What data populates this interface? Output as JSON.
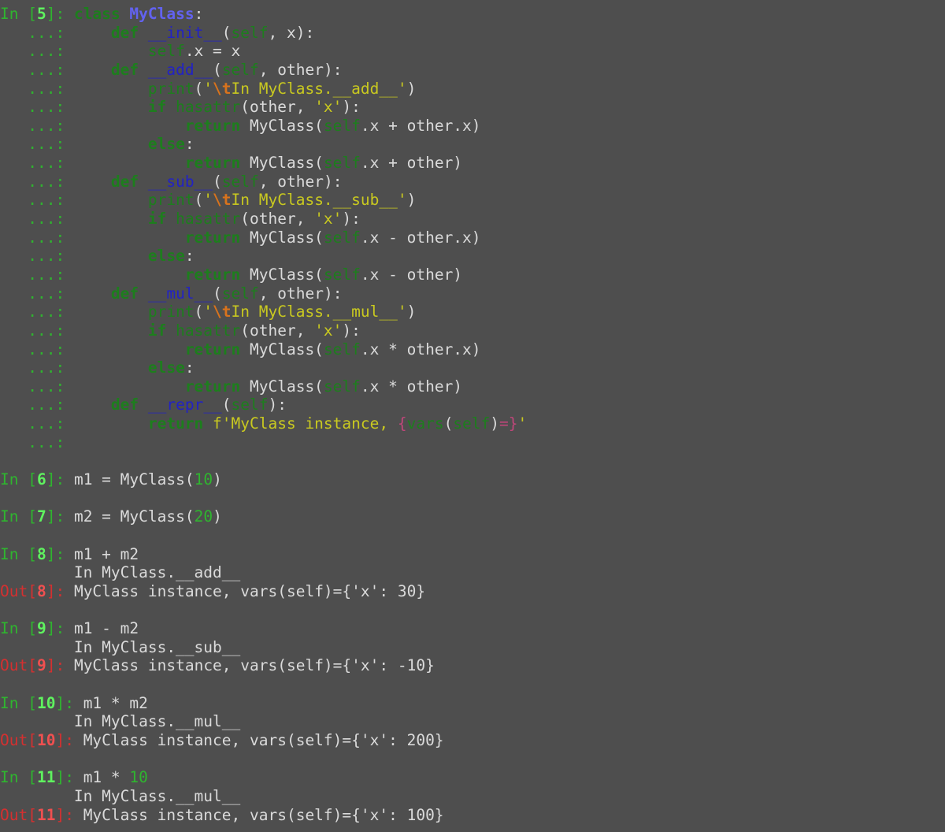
{
  "window": {
    "title": "IPython terminal session"
  },
  "colors": {
    "background": "#4e4e4e",
    "prompt_in": "#2fb52f",
    "prompt_out": "#d43030",
    "keyword": "#1d7e1d",
    "string": "#c9c920",
    "class_name": "#6262f0",
    "function_name": "#2222c4"
  },
  "lines": [
    {
      "segs": [
        {
          "t": "In [",
          "c": "prompt-in"
        },
        {
          "t": "5",
          "c": "prompt-num"
        },
        {
          "t": "]: ",
          "c": "prompt-in"
        },
        {
          "t": "class",
          "c": "kw"
        },
        {
          "t": " ",
          "c": "default"
        },
        {
          "t": "MyClass",
          "c": "classname"
        },
        {
          "t": ":",
          "c": "default"
        }
      ]
    },
    {
      "segs": [
        {
          "t": "   ...: ",
          "c": "cont"
        },
        {
          "t": "    ",
          "c": "default"
        },
        {
          "t": "def",
          "c": "kw"
        },
        {
          "t": " ",
          "c": "default"
        },
        {
          "t": "__init__",
          "c": "func"
        },
        {
          "t": "(",
          "c": "default"
        },
        {
          "t": "self",
          "c": "self"
        },
        {
          "t": ", x):",
          "c": "default"
        }
      ]
    },
    {
      "segs": [
        {
          "t": "   ...: ",
          "c": "cont"
        },
        {
          "t": "        ",
          "c": "default"
        },
        {
          "t": "self",
          "c": "self"
        },
        {
          "t": ".x = x",
          "c": "default"
        }
      ]
    },
    {
      "segs": [
        {
          "t": "   ...: ",
          "c": "cont"
        },
        {
          "t": "    ",
          "c": "default"
        },
        {
          "t": "def",
          "c": "kw"
        },
        {
          "t": " ",
          "c": "default"
        },
        {
          "t": "__add__",
          "c": "func"
        },
        {
          "t": "(",
          "c": "default"
        },
        {
          "t": "self",
          "c": "self"
        },
        {
          "t": ", other):",
          "c": "default"
        }
      ]
    },
    {
      "segs": [
        {
          "t": "   ...: ",
          "c": "cont"
        },
        {
          "t": "        ",
          "c": "default"
        },
        {
          "t": "print",
          "c": "builtin"
        },
        {
          "t": "(",
          "c": "default"
        },
        {
          "t": "'",
          "c": "str"
        },
        {
          "t": "\\t",
          "c": "escape"
        },
        {
          "t": "In MyClass.__add__'",
          "c": "str"
        },
        {
          "t": ")",
          "c": "default"
        }
      ]
    },
    {
      "segs": [
        {
          "t": "   ...: ",
          "c": "cont"
        },
        {
          "t": "        ",
          "c": "default"
        },
        {
          "t": "if",
          "c": "kw"
        },
        {
          "t": " ",
          "c": "default"
        },
        {
          "t": "hasattr",
          "c": "builtin"
        },
        {
          "t": "(other, ",
          "c": "default"
        },
        {
          "t": "'x'",
          "c": "str"
        },
        {
          "t": "):",
          "c": "default"
        }
      ]
    },
    {
      "segs": [
        {
          "t": "   ...: ",
          "c": "cont"
        },
        {
          "t": "            ",
          "c": "default"
        },
        {
          "t": "return",
          "c": "kw"
        },
        {
          "t": " MyClass(",
          "c": "default"
        },
        {
          "t": "self",
          "c": "self"
        },
        {
          "t": ".x + other.x)",
          "c": "default"
        }
      ]
    },
    {
      "segs": [
        {
          "t": "   ...: ",
          "c": "cont"
        },
        {
          "t": "        ",
          "c": "default"
        },
        {
          "t": "else",
          "c": "kw"
        },
        {
          "t": ":",
          "c": "default"
        }
      ]
    },
    {
      "segs": [
        {
          "t": "   ...: ",
          "c": "cont"
        },
        {
          "t": "            ",
          "c": "default"
        },
        {
          "t": "return",
          "c": "kw"
        },
        {
          "t": " MyClass(",
          "c": "default"
        },
        {
          "t": "self",
          "c": "self"
        },
        {
          "t": ".x + other)",
          "c": "default"
        }
      ]
    },
    {
      "segs": [
        {
          "t": "   ...: ",
          "c": "cont"
        },
        {
          "t": "    ",
          "c": "default"
        },
        {
          "t": "def",
          "c": "kw"
        },
        {
          "t": " ",
          "c": "default"
        },
        {
          "t": "__sub__",
          "c": "func"
        },
        {
          "t": "(",
          "c": "default"
        },
        {
          "t": "self",
          "c": "self"
        },
        {
          "t": ", other):",
          "c": "default"
        }
      ]
    },
    {
      "segs": [
        {
          "t": "   ...: ",
          "c": "cont"
        },
        {
          "t": "        ",
          "c": "default"
        },
        {
          "t": "print",
          "c": "builtin"
        },
        {
          "t": "(",
          "c": "default"
        },
        {
          "t": "'",
          "c": "str"
        },
        {
          "t": "\\t",
          "c": "escape"
        },
        {
          "t": "In MyClass.__sub__'",
          "c": "str"
        },
        {
          "t": ")",
          "c": "default"
        }
      ]
    },
    {
      "segs": [
        {
          "t": "   ...: ",
          "c": "cont"
        },
        {
          "t": "        ",
          "c": "default"
        },
        {
          "t": "if",
          "c": "kw"
        },
        {
          "t": " ",
          "c": "default"
        },
        {
          "t": "hasattr",
          "c": "builtin"
        },
        {
          "t": "(other, ",
          "c": "default"
        },
        {
          "t": "'x'",
          "c": "str"
        },
        {
          "t": "):",
          "c": "default"
        }
      ]
    },
    {
      "segs": [
        {
          "t": "   ...: ",
          "c": "cont"
        },
        {
          "t": "            ",
          "c": "default"
        },
        {
          "t": "return",
          "c": "kw"
        },
        {
          "t": " MyClass(",
          "c": "default"
        },
        {
          "t": "self",
          "c": "self"
        },
        {
          "t": ".x - other.x)",
          "c": "default"
        }
      ]
    },
    {
      "segs": [
        {
          "t": "   ...: ",
          "c": "cont"
        },
        {
          "t": "        ",
          "c": "default"
        },
        {
          "t": "else",
          "c": "kw"
        },
        {
          "t": ":",
          "c": "default"
        }
      ]
    },
    {
      "segs": [
        {
          "t": "   ...: ",
          "c": "cont"
        },
        {
          "t": "            ",
          "c": "default"
        },
        {
          "t": "return",
          "c": "kw"
        },
        {
          "t": " MyClass(",
          "c": "default"
        },
        {
          "t": "self",
          "c": "self"
        },
        {
          "t": ".x - other)",
          "c": "default"
        }
      ]
    },
    {
      "segs": [
        {
          "t": "   ...: ",
          "c": "cont"
        },
        {
          "t": "    ",
          "c": "default"
        },
        {
          "t": "def",
          "c": "kw"
        },
        {
          "t": " ",
          "c": "default"
        },
        {
          "t": "__mul__",
          "c": "func"
        },
        {
          "t": "(",
          "c": "default"
        },
        {
          "t": "self",
          "c": "self"
        },
        {
          "t": ", other):",
          "c": "default"
        }
      ]
    },
    {
      "segs": [
        {
          "t": "   ...: ",
          "c": "cont"
        },
        {
          "t": "        ",
          "c": "default"
        },
        {
          "t": "print",
          "c": "builtin"
        },
        {
          "t": "(",
          "c": "default"
        },
        {
          "t": "'",
          "c": "str"
        },
        {
          "t": "\\t",
          "c": "escape"
        },
        {
          "t": "In MyClass.__mul__'",
          "c": "str"
        },
        {
          "t": ")",
          "c": "default"
        }
      ]
    },
    {
      "segs": [
        {
          "t": "   ...: ",
          "c": "cont"
        },
        {
          "t": "        ",
          "c": "default"
        },
        {
          "t": "if",
          "c": "kw"
        },
        {
          "t": " ",
          "c": "default"
        },
        {
          "t": "hasattr",
          "c": "builtin"
        },
        {
          "t": "(other, ",
          "c": "default"
        },
        {
          "t": "'x'",
          "c": "str"
        },
        {
          "t": "):",
          "c": "default"
        }
      ]
    },
    {
      "segs": [
        {
          "t": "   ...: ",
          "c": "cont"
        },
        {
          "t": "            ",
          "c": "default"
        },
        {
          "t": "return",
          "c": "kw"
        },
        {
          "t": " MyClass(",
          "c": "default"
        },
        {
          "t": "self",
          "c": "self"
        },
        {
          "t": ".x * other.x)",
          "c": "default"
        }
      ]
    },
    {
      "segs": [
        {
          "t": "   ...: ",
          "c": "cont"
        },
        {
          "t": "        ",
          "c": "default"
        },
        {
          "t": "else",
          "c": "kw"
        },
        {
          "t": ":",
          "c": "default"
        }
      ]
    },
    {
      "segs": [
        {
          "t": "   ...: ",
          "c": "cont"
        },
        {
          "t": "            ",
          "c": "default"
        },
        {
          "t": "return",
          "c": "kw"
        },
        {
          "t": " MyClass(",
          "c": "default"
        },
        {
          "t": "self",
          "c": "self"
        },
        {
          "t": ".x * other)",
          "c": "default"
        }
      ]
    },
    {
      "segs": [
        {
          "t": "   ...: ",
          "c": "cont"
        },
        {
          "t": "    ",
          "c": "default"
        },
        {
          "t": "def",
          "c": "kw"
        },
        {
          "t": " ",
          "c": "default"
        },
        {
          "t": "__repr__",
          "c": "func"
        },
        {
          "t": "(",
          "c": "default"
        },
        {
          "t": "self",
          "c": "self"
        },
        {
          "t": "):",
          "c": "default"
        }
      ]
    },
    {
      "segs": [
        {
          "t": "   ...: ",
          "c": "cont"
        },
        {
          "t": "        ",
          "c": "default"
        },
        {
          "t": "return",
          "c": "kw"
        },
        {
          "t": " ",
          "c": "default"
        },
        {
          "t": "f'MyClass instance, ",
          "c": "str"
        },
        {
          "t": "{",
          "c": "interp"
        },
        {
          "t": "vars",
          "c": "builtin"
        },
        {
          "t": "(",
          "c": "default"
        },
        {
          "t": "self",
          "c": "self"
        },
        {
          "t": ")",
          "c": "default"
        },
        {
          "t": "=}",
          "c": "interp"
        },
        {
          "t": "'",
          "c": "str"
        }
      ]
    },
    {
      "segs": [
        {
          "t": "   ...: ",
          "c": "cont"
        }
      ]
    },
    {
      "segs": []
    },
    {
      "segs": [
        {
          "t": "In [",
          "c": "prompt-in"
        },
        {
          "t": "6",
          "c": "prompt-num"
        },
        {
          "t": "]: ",
          "c": "prompt-in"
        },
        {
          "t": "m1 = MyClass(",
          "c": "default"
        },
        {
          "t": "10",
          "c": "number"
        },
        {
          "t": ")",
          "c": "default"
        }
      ]
    },
    {
      "segs": []
    },
    {
      "segs": [
        {
          "t": "In [",
          "c": "prompt-in"
        },
        {
          "t": "7",
          "c": "prompt-num"
        },
        {
          "t": "]: ",
          "c": "prompt-in"
        },
        {
          "t": "m2 = MyClass(",
          "c": "default"
        },
        {
          "t": "20",
          "c": "number"
        },
        {
          "t": ")",
          "c": "default"
        }
      ]
    },
    {
      "segs": []
    },
    {
      "segs": [
        {
          "t": "In [",
          "c": "prompt-in"
        },
        {
          "t": "8",
          "c": "prompt-num"
        },
        {
          "t": "]: ",
          "c": "prompt-in"
        },
        {
          "t": "m1 + m2",
          "c": "default"
        }
      ]
    },
    {
      "segs": [
        {
          "t": "        In MyClass.__add__",
          "c": "default"
        }
      ]
    },
    {
      "segs": [
        {
          "t": "Out[",
          "c": "out"
        },
        {
          "t": "8",
          "c": "out-num"
        },
        {
          "t": "]: ",
          "c": "out"
        },
        {
          "t": "MyClass instance, vars(self)={'x': 30}",
          "c": "default"
        }
      ]
    },
    {
      "segs": []
    },
    {
      "segs": [
        {
          "t": "In [",
          "c": "prompt-in"
        },
        {
          "t": "9",
          "c": "prompt-num"
        },
        {
          "t": "]: ",
          "c": "prompt-in"
        },
        {
          "t": "m1 - m2",
          "c": "default"
        }
      ]
    },
    {
      "segs": [
        {
          "t": "        In MyClass.__sub__",
          "c": "default"
        }
      ]
    },
    {
      "segs": [
        {
          "t": "Out[",
          "c": "out"
        },
        {
          "t": "9",
          "c": "out-num"
        },
        {
          "t": "]: ",
          "c": "out"
        },
        {
          "t": "MyClass instance, vars(self)={'x': -10}",
          "c": "default"
        }
      ]
    },
    {
      "segs": []
    },
    {
      "segs": [
        {
          "t": "In [",
          "c": "prompt-in"
        },
        {
          "t": "10",
          "c": "prompt-num"
        },
        {
          "t": "]: ",
          "c": "prompt-in"
        },
        {
          "t": "m1 * m2",
          "c": "default"
        }
      ]
    },
    {
      "segs": [
        {
          "t": "        In MyClass.__mul__",
          "c": "default"
        }
      ]
    },
    {
      "segs": [
        {
          "t": "Out[",
          "c": "out"
        },
        {
          "t": "10",
          "c": "out-num"
        },
        {
          "t": "]: ",
          "c": "out"
        },
        {
          "t": "MyClass instance, vars(self)={'x': 200}",
          "c": "default"
        }
      ]
    },
    {
      "segs": []
    },
    {
      "segs": [
        {
          "t": "In [",
          "c": "prompt-in"
        },
        {
          "t": "11",
          "c": "prompt-num"
        },
        {
          "t": "]: ",
          "c": "prompt-in"
        },
        {
          "t": "m1 * ",
          "c": "default"
        },
        {
          "t": "10",
          "c": "number"
        }
      ]
    },
    {
      "segs": [
        {
          "t": "        In MyClass.__mul__",
          "c": "default"
        }
      ]
    },
    {
      "segs": [
        {
          "t": "Out[",
          "c": "out"
        },
        {
          "t": "11",
          "c": "out-num"
        },
        {
          "t": "]: ",
          "c": "out"
        },
        {
          "t": "MyClass instance, vars(self)={'x': 100}",
          "c": "default"
        }
      ]
    }
  ]
}
